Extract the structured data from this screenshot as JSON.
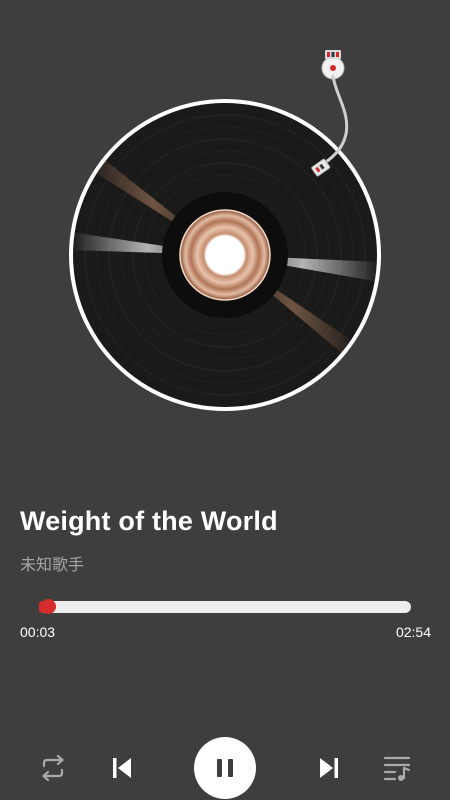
{
  "player": {
    "title": "Weight of the World",
    "artist": "未知歌手",
    "elapsed": "00:03",
    "total": "02:54",
    "progress_fraction": 0.017
  },
  "controls": {
    "repeat_icon": "repeat-icon",
    "previous_icon": "skip-previous-icon",
    "play_pause_icon": "pause-icon",
    "next_icon": "skip-next-icon",
    "playlist_icon": "playlist-icon"
  },
  "colors": {
    "background": "#3e3e3e",
    "accent": "#d52b2b",
    "track": "#eeeeee",
    "secondary_text": "#a5a5a5"
  }
}
